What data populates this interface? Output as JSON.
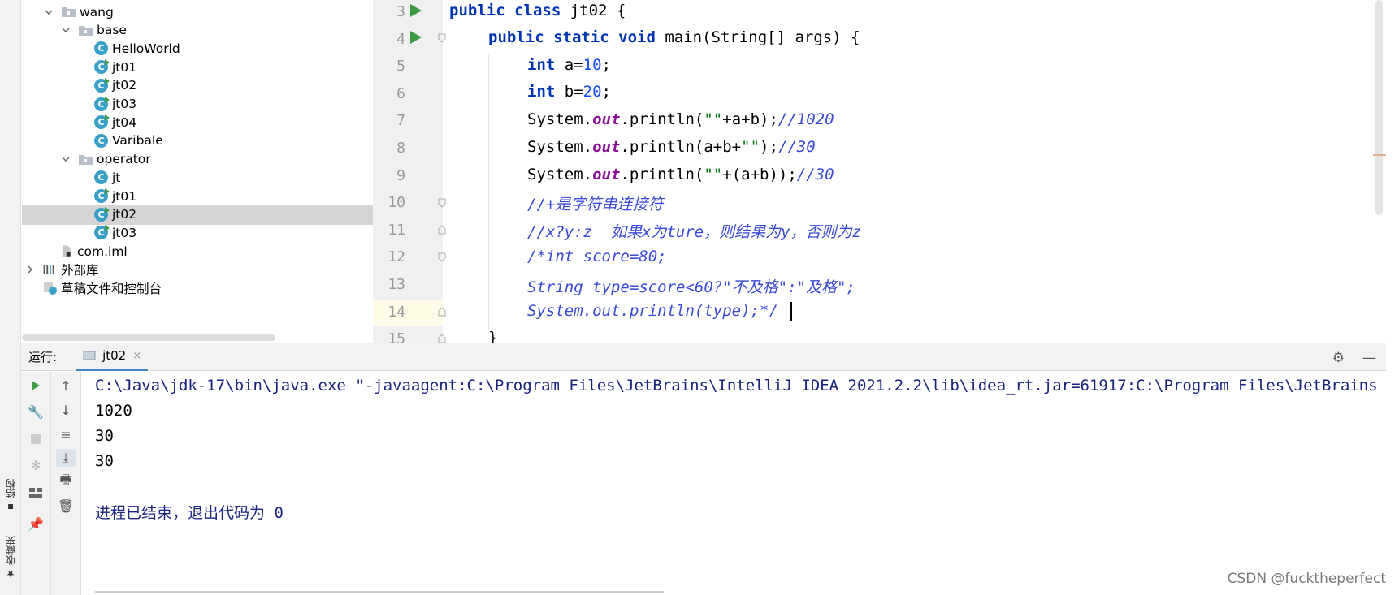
{
  "left_strip": {
    "structure_label": "结构",
    "favorites_label": "收藏夹"
  },
  "project_tree": {
    "items": [
      {
        "label": "wang",
        "type": "folder",
        "depth": 0,
        "expanded": true
      },
      {
        "label": "base",
        "type": "folder",
        "depth": 1,
        "expanded": true
      },
      {
        "label": "HelloWorld",
        "type": "class",
        "depth": 2,
        "runnable": false
      },
      {
        "label": "jt01",
        "type": "class",
        "depth": 2,
        "runnable": true
      },
      {
        "label": "jt02",
        "type": "class",
        "depth": 2,
        "runnable": true
      },
      {
        "label": "jt03",
        "type": "class",
        "depth": 2,
        "runnable": true
      },
      {
        "label": "jt04",
        "type": "class",
        "depth": 2,
        "runnable": true
      },
      {
        "label": "Varibale",
        "type": "class",
        "depth": 2,
        "runnable": false
      },
      {
        "label": "operator",
        "type": "folder",
        "depth": 1,
        "expanded": true
      },
      {
        "label": "jt",
        "type": "class",
        "depth": 2,
        "runnable": false
      },
      {
        "label": "jt01",
        "type": "class",
        "depth": 2,
        "runnable": true
      },
      {
        "label": "jt02",
        "type": "class",
        "depth": 2,
        "runnable": true,
        "selected": true
      },
      {
        "label": "jt03",
        "type": "class",
        "depth": 2,
        "runnable": true
      },
      {
        "label": "com.iml",
        "type": "iml",
        "depth": 0
      },
      {
        "label": "外部库",
        "type": "library",
        "depth": -1,
        "expanded": false
      },
      {
        "label": "草稿文件和控制台",
        "type": "scratch",
        "depth": -1
      }
    ]
  },
  "editor": {
    "line_numbers": [
      "3",
      "4",
      "5",
      "6",
      "7",
      "8",
      "9",
      "10",
      "11",
      "12",
      "13",
      "14",
      "15"
    ],
    "current_line": "14",
    "code": {
      "l3": {
        "kw1": "public class ",
        "rest": "jt02 {"
      },
      "l4": {
        "kw1": "public static void ",
        "rest": "main(String[] args) {"
      },
      "l5": {
        "kw1": "int ",
        "a": "a=",
        "num": "10",
        "end": ";"
      },
      "l6": {
        "kw1": "int ",
        "a": "b=",
        "num": "20",
        "end": ";"
      },
      "l7": {
        "pre": "System.",
        "fld": "out",
        "mid": ".println(",
        "str": "\"\"",
        "post": "+a+b);",
        "cmt": "//1020"
      },
      "l8": {
        "pre": "System.",
        "fld": "out",
        "mid": ".println(a+b+",
        "str": "\"\"",
        "post": ");",
        "cmt": "//30"
      },
      "l9": {
        "pre": "System.",
        "fld": "out",
        "mid": ".println(",
        "str": "\"\"",
        "post": "+(a+b));",
        "cmt": "//30"
      },
      "l10": {
        "cmt": "//+是字符串连接符"
      },
      "l11": {
        "cmt": "//x?y:z  如果x为ture，则结果为y，否则为z"
      },
      "l12": {
        "cmt": "/*int score=80;"
      },
      "l13": {
        "cmt": "String type=score<60?\"不及格\":\"及格\";"
      },
      "l14": {
        "cmt": "System.out.println(type);*/"
      },
      "l15": {
        "rest": "}"
      }
    }
  },
  "run_panel": {
    "label": "运行:",
    "tab_name": "jt02",
    "tab_close": "×",
    "settings_icon": "gear-icon",
    "minimize_icon": "minimize-icon",
    "console": {
      "command": "C:\\Java\\jdk-17\\bin\\java.exe \"-javaagent:C:\\Program Files\\JetBrains\\IntelliJ IDEA 2021.2.2\\lib\\idea_rt.jar=61917:C:\\Program Files\\JetBrains",
      "outputs": [
        "1020",
        "30",
        "30"
      ],
      "exit_message": "进程已结束，退出代码为 0"
    }
  },
  "watermark": "CSDN @fucktheperfect",
  "colors": {
    "keyword": "#0033b3",
    "number": "#1750eb",
    "string": "#067d17",
    "field": "#871094",
    "comment": "#3c4ad8",
    "run_green": "#3d9a46",
    "class_icon": "#3ba0c8",
    "current_line": "#fdfae5"
  }
}
